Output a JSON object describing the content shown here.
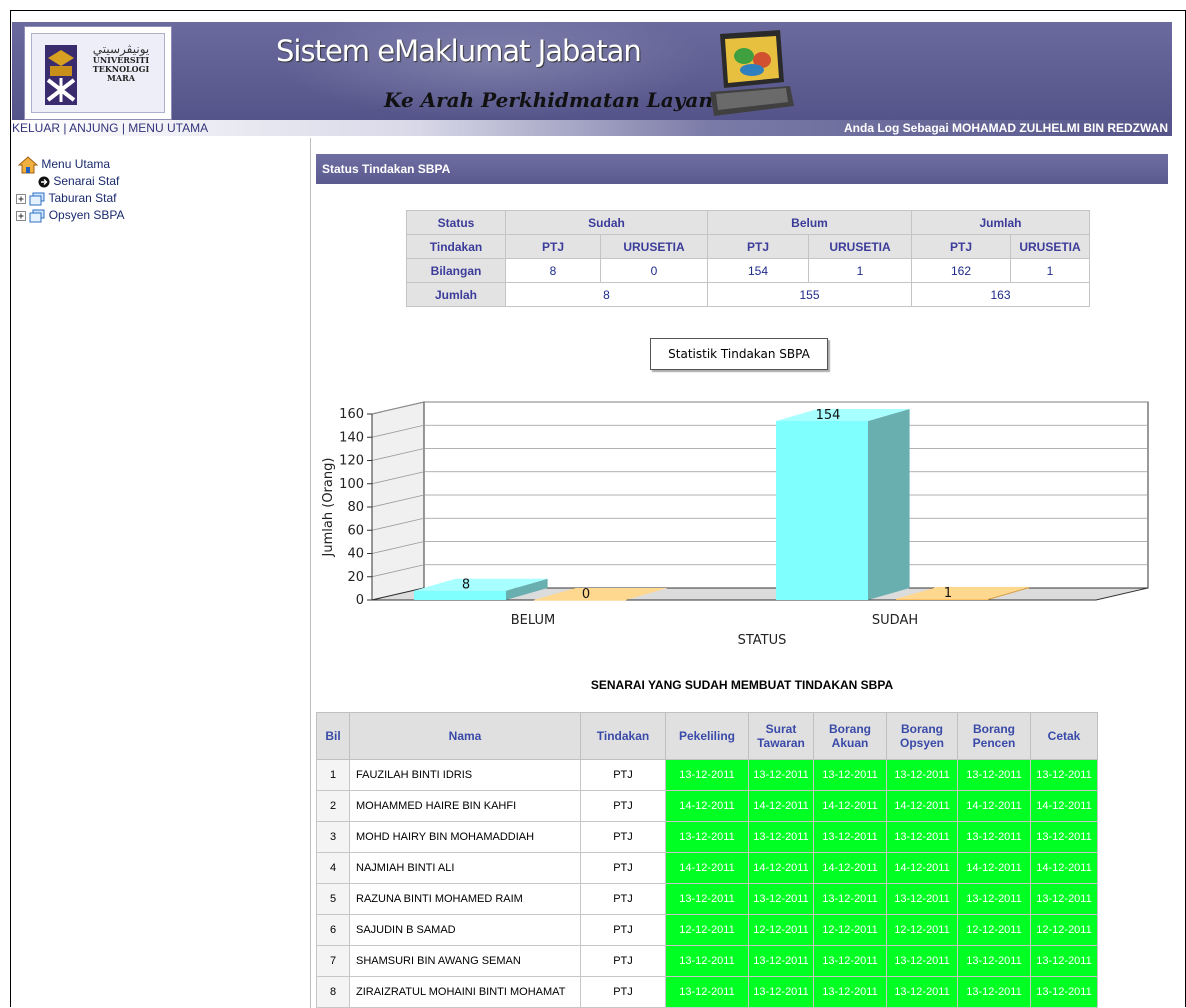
{
  "app": {
    "title": "Sistem eMaklumat Jabatan",
    "tagline": "Ke Arah Perkhidmatan Layan Diri",
    "logo": {
      "jawi": "ﻳﻮﻧﻴﭭﺮﺳﻴﺘﻲ",
      "line1": "UNIVERSITI",
      "line2": "TEKNOLOGI",
      "line3": "MARA"
    }
  },
  "nav": {
    "keluar": "KELUAR",
    "sep1": " | ",
    "anjung": "ANJUNG",
    "sep2": " | ",
    "menu_utama": "MENU UTAMA",
    "user_text": "Anda Log Sebagai MOHAMAD ZULHELMI BIN REDZWAN"
  },
  "sidebar": {
    "root": "Menu Utama",
    "items": [
      {
        "label": "Senarai Staf",
        "icon": "arrow-circle-icon"
      },
      {
        "label": "Taburan Staf",
        "icon": "window-icon"
      },
      {
        "label": "Opsyen SBPA",
        "icon": "window-icon"
      }
    ]
  },
  "main": {
    "section_title": "Status Tindakan SBPA",
    "summary": {
      "status_label": "Status",
      "sudah": "Sudah",
      "belum": "Belum",
      "jumlah": "Jumlah",
      "tindakan_label": "Tindakan",
      "ptj": "PTJ",
      "urusetia": "URUSETIA",
      "bilangan_label": "Bilangan",
      "bilangan": [
        "8",
        "0",
        "154",
        "1",
        "162",
        "1"
      ],
      "jumlah_label": "Jumlah",
      "jumlah_values": [
        "8",
        "155",
        "163"
      ]
    },
    "chart_caption": "Statistik Tindakan SBPA",
    "list_title": "SENARAI YANG SUDAH MEMBUAT TINDAKAN SBPA"
  },
  "chart_data": {
    "type": "bar",
    "categories": [
      "BELUM",
      "SUDAH"
    ],
    "series": [
      {
        "values": [
          8,
          154
        ],
        "color": "#80ffff"
      },
      {
        "values": [
          0,
          1
        ],
        "color": "#ffc060"
      }
    ],
    "xlabel": "STATUS",
    "ylabel": "Jumlah (Orang)",
    "ylim": [
      0,
      160
    ],
    "yticks": [
      "0",
      "20",
      "40",
      "60",
      "80",
      "100",
      "120",
      "140",
      "160"
    ],
    "grid": true
  },
  "staff_table": {
    "headers": [
      "Bil",
      "Nama",
      "Tindakan",
      "Pekeliling",
      "Surat Tawaran",
      "Borang Akuan",
      "Borang Opsyen",
      "Borang Pencen",
      "Cetak"
    ],
    "rows": [
      {
        "bil": "1",
        "nama": "FAUZILAH BINTI IDRIS",
        "tindakan": "PTJ",
        "dates": [
          "13-12-2011",
          "13-12-2011",
          "13-12-2011",
          "13-12-2011",
          "13-12-2011",
          "13-12-2011"
        ]
      },
      {
        "bil": "2",
        "nama": "MOHAMMED HAIRE BIN KAHFI",
        "tindakan": "PTJ",
        "dates": [
          "14-12-2011",
          "14-12-2011",
          "14-12-2011",
          "14-12-2011",
          "14-12-2011",
          "14-12-2011"
        ]
      },
      {
        "bil": "3",
        "nama": "MOHD HAIRY BIN MOHAMADDIAH",
        "tindakan": "PTJ",
        "dates": [
          "13-12-2011",
          "13-12-2011",
          "13-12-2011",
          "13-12-2011",
          "13-12-2011",
          "13-12-2011"
        ]
      },
      {
        "bil": "4",
        "nama": "NAJMIAH BINTI ALI",
        "tindakan": "PTJ",
        "dates": [
          "14-12-2011",
          "14-12-2011",
          "14-12-2011",
          "14-12-2011",
          "14-12-2011",
          "14-12-2011"
        ]
      },
      {
        "bil": "5",
        "nama": "RAZUNA BINTI MOHAMED RAIM",
        "tindakan": "PTJ",
        "dates": [
          "13-12-2011",
          "13-12-2011",
          "13-12-2011",
          "13-12-2011",
          "13-12-2011",
          "13-12-2011"
        ]
      },
      {
        "bil": "6",
        "nama": "SAJUDIN B SAMAD",
        "tindakan": "PTJ",
        "dates": [
          "12-12-2011",
          "12-12-2011",
          "12-12-2011",
          "12-12-2011",
          "12-12-2011",
          "12-12-2011"
        ]
      },
      {
        "bil": "7",
        "nama": "SHAMSURI BIN AWANG SEMAN",
        "tindakan": "PTJ",
        "dates": [
          "13-12-2011",
          "13-12-2011",
          "13-12-2011",
          "13-12-2011",
          "13-12-2011",
          "13-12-2011"
        ]
      },
      {
        "bil": "8",
        "nama": "ZIRAIZRATUL MOHAINI BINTI MOHAMAT",
        "tindakan": "PTJ",
        "dates": [
          "13-12-2011",
          "13-12-2011",
          "13-12-2011",
          "13-12-2011",
          "13-12-2011",
          "13-12-2011"
        ]
      }
    ]
  }
}
